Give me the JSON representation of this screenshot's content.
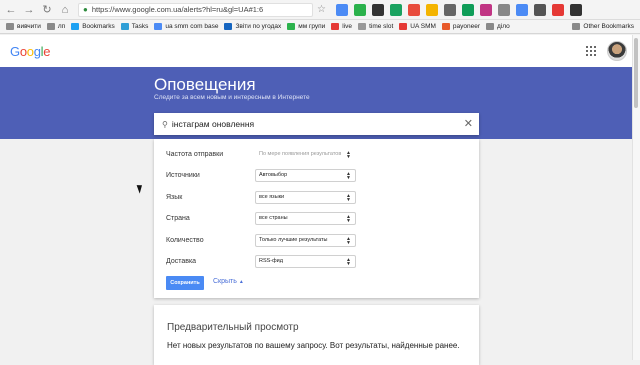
{
  "browser": {
    "url": "https://www.google.com.ua/alerts?hl=ru&gl=UA#1:6",
    "bookmarks": [
      "вивчити",
      "лп",
      "Bookmarks",
      "Tasks",
      "ua smm com base",
      "Звіти по угодах",
      "мм групи",
      "live",
      "time slot",
      "UA SMM",
      "payoneer",
      "діло"
    ],
    "other_bookmarks": "Other Bookmarks"
  },
  "header": {
    "logo": "Google"
  },
  "banner": {
    "title": "Оповещения",
    "subtitle": "Следите за всем новым и интересным в Интернете"
  },
  "search": {
    "value": "інстаграм оновлення"
  },
  "options": [
    {
      "label": "Частота отправки",
      "value": "По мере появления результатов"
    },
    {
      "label": "Источники",
      "value": "Автовыбор"
    },
    {
      "label": "Язык",
      "value": "все языки"
    },
    {
      "label": "Страна",
      "value": "все страны"
    },
    {
      "label": "Количество",
      "value": "Только лучшие результаты"
    },
    {
      "label": "Доставка",
      "value": "RSS-фид"
    }
  ],
  "actions": {
    "save": "Сохранить",
    "hide": "Скрыть"
  },
  "preview": {
    "title": "Предварительный просмотр",
    "message": "Нет новых результатов по вашему запросу. Вот результаты, найденные ранее."
  },
  "colors": {
    "banner": "#4e5fb6",
    "save_button": "#4a8af4"
  }
}
